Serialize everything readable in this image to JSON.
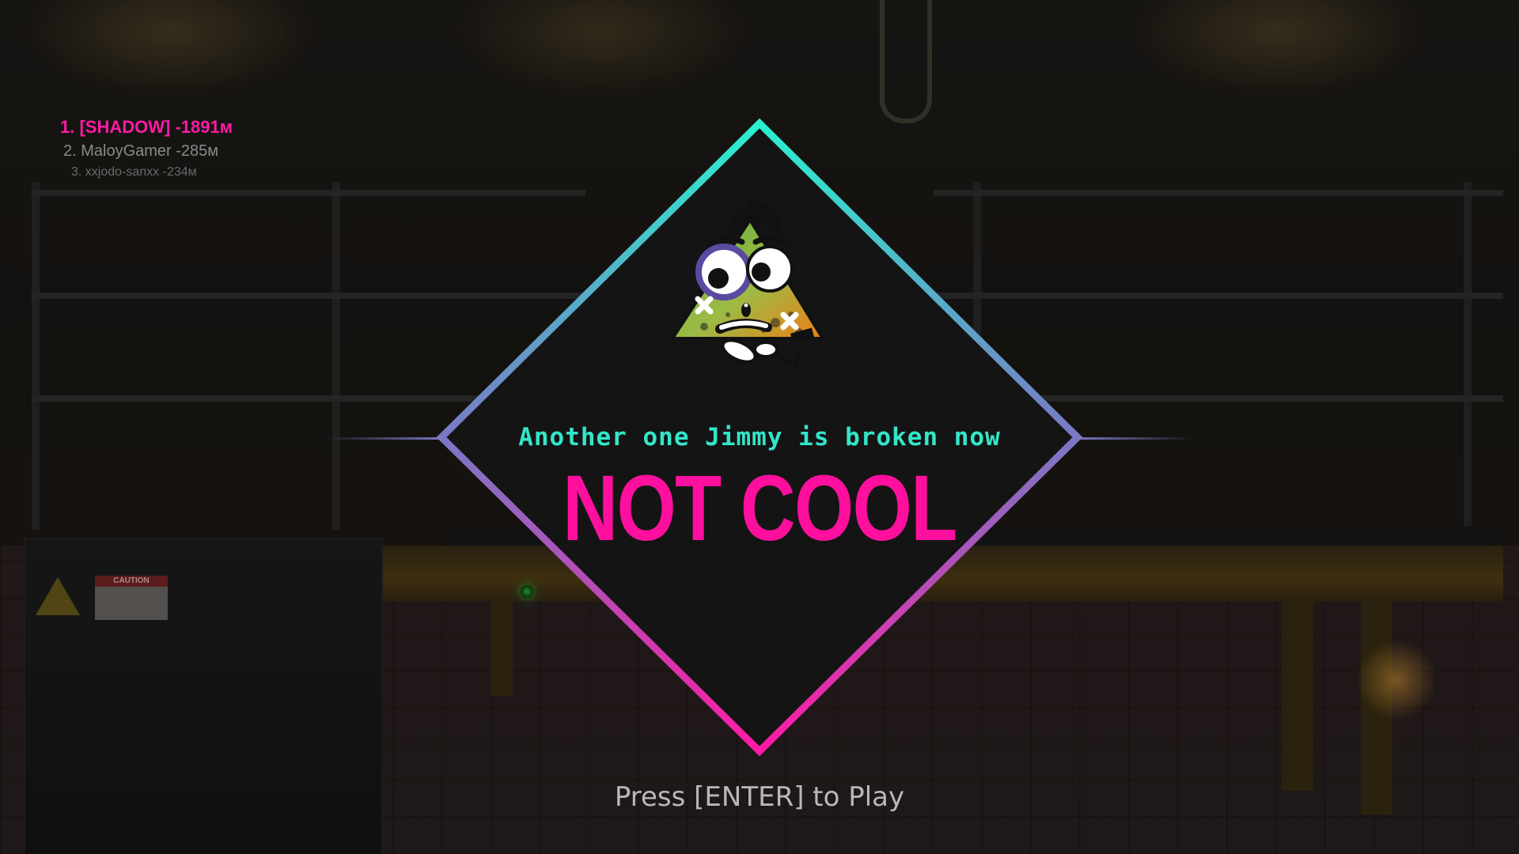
{
  "leaderboard": {
    "entries": [
      {
        "rank": "1.",
        "name": "[SHADOW]",
        "score": "-1891м",
        "text": "1. [SHADOW] -1891м"
      },
      {
        "rank": "2.",
        "name": "MaloyGamer",
        "score": "-285м",
        "text": "2. MaloyGamer -285м"
      },
      {
        "rank": "3.",
        "name": "xxjodo-sanxx",
        "score": "-234м",
        "text": "3. xxjodo-sanxx -234м"
      }
    ]
  },
  "game_over": {
    "subtitle": "Another one Jimmy is broken now",
    "headline": "NOT COOL",
    "prompt": "Press [ENTER] to Play"
  },
  "background": {
    "caution_sign": "CAUTION"
  },
  "colors": {
    "accent_pink": "#ff0f9e",
    "accent_cyan": "#33e6c9",
    "border_mid": "#7a78c4",
    "prompt_gray": "#b8b8b8"
  },
  "icons": [
    "broken-jimmy-character-icon",
    "warning-triangle-icon",
    "hook-icon"
  ]
}
